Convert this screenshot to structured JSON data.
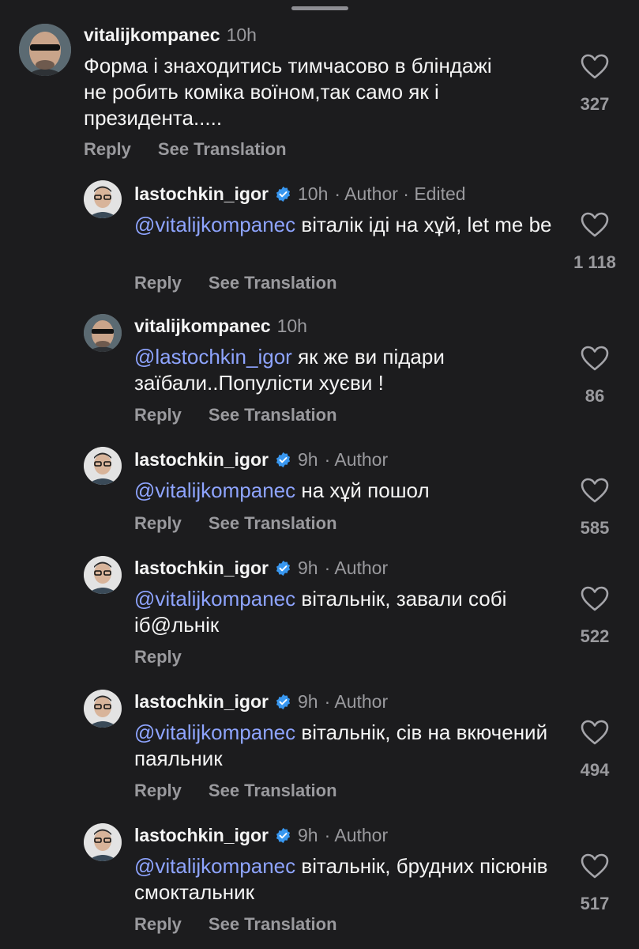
{
  "comments": [
    {
      "username": "vitalijkompanec",
      "time": "10h",
      "extra": "",
      "verified": false,
      "mention": "",
      "text": "Форма і знаходитись тимчасово в бліндажі не робить коміка воїном,так само як і президента.....",
      "likes": "327",
      "reply_label": "Reply",
      "translate_label": "See Translation",
      "avatar_icon": "bald-man-sunglasses-avatar"
    },
    {
      "username": "lastochkin_igor",
      "time": "10h",
      "extra": "· Author · Edited",
      "verified": true,
      "mention": "@vitalijkompanec",
      "text": "віталік іді на хұй, let me be",
      "likes": "1 118",
      "reply_label": "Reply",
      "translate_label": "See Translation",
      "avatar_icon": "man-glasses-avatar"
    },
    {
      "username": "vitalijkompanec",
      "time": "10h",
      "extra": "",
      "verified": false,
      "mention": "@lastochkin_igor",
      "text": "як же ви підари заїбали..Популісти хуєви !",
      "likes": "86",
      "reply_label": "Reply",
      "translate_label": "See Translation",
      "avatar_icon": "bald-man-sunglasses-avatar"
    },
    {
      "username": "lastochkin_igor",
      "time": "9h",
      "extra": "· Author",
      "verified": true,
      "mention": "@vitalijkompanec",
      "text": "на хұй пошол",
      "likes": "585",
      "reply_label": "Reply",
      "translate_label": "See Translation",
      "avatar_icon": "man-glasses-avatar"
    },
    {
      "username": "lastochkin_igor",
      "time": "9h",
      "extra": "· Author",
      "verified": true,
      "mention": "@vitalijkompanec",
      "text": "вітальнік, завали собі іб@льнік",
      "likes": "522",
      "reply_label": "Reply",
      "translate_label": "",
      "avatar_icon": "man-glasses-avatar"
    },
    {
      "username": "lastochkin_igor",
      "time": "9h",
      "extra": "· Author",
      "verified": true,
      "mention": "@vitalijkompanec",
      "text": "вітальнік, сів на вкючений паяльник",
      "likes": "494",
      "reply_label": "Reply",
      "translate_label": "See Translation",
      "avatar_icon": "man-glasses-avatar"
    },
    {
      "username": "lastochkin_igor",
      "time": "9h",
      "extra": "· Author",
      "verified": true,
      "mention": "@vitalijkompanec",
      "text": "вітальнік, брудних пісюнів смоктальник",
      "likes": "517",
      "reply_label": "Reply",
      "translate_label": "See Translation",
      "avatar_icon": "man-glasses-avatar"
    }
  ],
  "colors": {
    "background": "#1c1c1e",
    "mention": "#8ea4ff",
    "verified": "#3897f0",
    "muted": "#9a9a9e"
  }
}
